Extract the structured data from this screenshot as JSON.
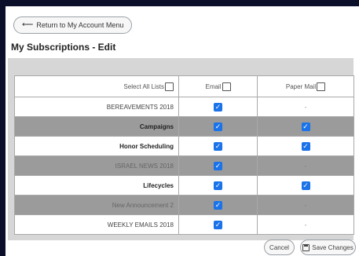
{
  "nav": {
    "return_label": "Return to My Account Menu"
  },
  "page": {
    "title": "My Subscriptions - Edit"
  },
  "table": {
    "headers": {
      "select_all": "Select All Lists",
      "email": "Email",
      "paper_mail": "Paper Mail"
    },
    "rows": [
      {
        "name": "BEREAVEMENTS 2018",
        "bold": false,
        "shade": "white",
        "email": "checked",
        "paper": "-"
      },
      {
        "name": "Campaigns",
        "bold": true,
        "shade": "grey",
        "email": "checked",
        "paper": "checked"
      },
      {
        "name": "Honor Scheduling",
        "bold": true,
        "shade": "white",
        "email": "checked",
        "paper": "checked"
      },
      {
        "name": "ISRAEL NEWS 2018",
        "bold": false,
        "shade": "grey",
        "email": "checked",
        "paper": "-"
      },
      {
        "name": "Lifecycles",
        "bold": true,
        "shade": "white",
        "email": "checked",
        "paper": "checked"
      },
      {
        "name": "New Announcement 2",
        "bold": false,
        "shade": "grey",
        "email": "checked",
        "paper": "-"
      },
      {
        "name": "WEEKLY EMAILS 2018",
        "bold": false,
        "shade": "white",
        "email": "checked",
        "paper": "-"
      }
    ]
  },
  "footer": {
    "cancel_label": "Cancel",
    "save_label": "Save Changes"
  },
  "colors": {
    "checkbox_accent": "#1a73e8",
    "grey_row": "#9b9b9b",
    "frame": "#0b0f2a"
  },
  "icons": {
    "return": "arrow-left-icon",
    "save": "floppy-disk-icon",
    "checkbox": "checkmark-icon"
  }
}
